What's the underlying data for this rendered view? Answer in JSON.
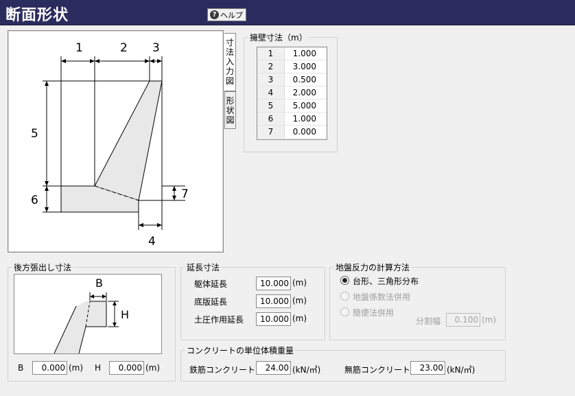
{
  "header": {
    "title": "断面形状",
    "help_label": "ヘルプ",
    "help_icon": "question-circle-icon"
  },
  "tabs": {
    "dims": "寸法入力図",
    "shape": "形状図"
  },
  "diagram": {
    "labels": {
      "d1": "1",
      "d2": "2",
      "d3": "3",
      "d4": "4",
      "d5": "5",
      "d6": "6",
      "d7": "7"
    }
  },
  "wall_dims": {
    "title": "擁壁寸法（m）",
    "rows": [
      {
        "num": "1",
        "value": "1.000"
      },
      {
        "num": "2",
        "value": "3.000"
      },
      {
        "num": "3",
        "value": "0.500"
      },
      {
        "num": "4",
        "value": "2.000"
      },
      {
        "num": "5",
        "value": "5.000"
      },
      {
        "num": "6",
        "value": "1.000"
      },
      {
        "num": "7",
        "value": "0.000"
      }
    ]
  },
  "rear_ext": {
    "title": "後方張出し寸法",
    "b_tag": "B",
    "h_tag": "H",
    "b_label": "B",
    "b_value": "0.000",
    "b_unit": "(m)",
    "h_label": "H",
    "h_value": "0.000",
    "h_unit": "(m)"
  },
  "ext_len": {
    "title": "延長寸法",
    "body_label": "躯体延長",
    "body_value": "10.000",
    "body_unit": "(m)",
    "base_label": "底版延長",
    "base_value": "10.000",
    "base_unit": "(m)",
    "earth_label": "土圧作用延長",
    "earth_value": "10.000",
    "earth_unit": "(m)"
  },
  "soil": {
    "title": "地盤反力の計算方法",
    "opt1": "台形、三角形分布",
    "opt2": "地盤係数法併用",
    "opt3": "簡便法併用",
    "div_label": "分割幅",
    "div_value": "0.100",
    "div_unit": "(m)"
  },
  "conc": {
    "title": "コンクリートの単位体積重量",
    "rc_label": "鉄筋コンクリート",
    "rc_value": "24.00",
    "rc_unit": "(kN/㎥)",
    "pc_label": "無筋コンクリート",
    "pc_value": "23.00",
    "pc_unit": "(kN/㎥)"
  }
}
